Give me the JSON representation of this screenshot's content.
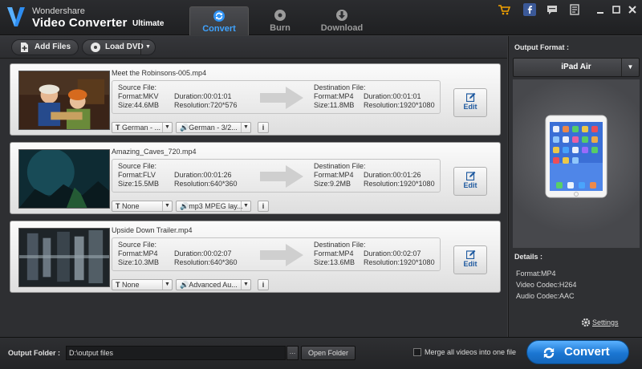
{
  "app": {
    "brand_line1": "Wondershare",
    "brand_line2": "Video Converter",
    "brand_edition": "Ultimate"
  },
  "tabs": [
    {
      "label": "Convert",
      "active": true
    },
    {
      "label": "Burn",
      "active": false
    },
    {
      "label": "Download",
      "active": false
    }
  ],
  "toolbar": {
    "add_files": "Add Files",
    "load_dvd": "Load DVD"
  },
  "files": [
    {
      "name": "Meet the Robinsons-005.mp4",
      "source": {
        "label": "Source File:",
        "format": "Format:MKV",
        "size": "Size:44.6MB",
        "duration": "Duration:00:01:01",
        "resolution": "Resolution:720*576"
      },
      "dest": {
        "label": "Destination File:",
        "format": "Format:MP4",
        "size": "Size:11.8MB",
        "duration": "Duration:00:01:01",
        "resolution": "Resolution:1920*1080"
      },
      "subtitle": "German - ...",
      "audio": "German - 3/2...",
      "edit": "Edit"
    },
    {
      "name": "Amazing_Caves_720.mp4",
      "source": {
        "label": "Source File:",
        "format": "Format:FLV",
        "size": "Size:15.5MB",
        "duration": "Duration:00:01:26",
        "resolution": "Resolution:640*360"
      },
      "dest": {
        "label": "Destination File:",
        "format": "Format:MP4",
        "size": "Size:9.2MB",
        "duration": "Duration:00:01:26",
        "resolution": "Resolution:1920*1080"
      },
      "subtitle": "None",
      "audio": "mp3 MPEG lay...",
      "edit": "Edit"
    },
    {
      "name": "Upside Down Trailer.mp4",
      "source": {
        "label": "Source File:",
        "format": "Format:MP4",
        "size": "Size:10.3MB",
        "duration": "Duration:00:02:07",
        "resolution": "Resolution:640*360"
      },
      "dest": {
        "label": "Destination File:",
        "format": "Format:MP4",
        "size": "Size:13.6MB",
        "duration": "Duration:00:02:07",
        "resolution": "Resolution:1920*1080"
      },
      "subtitle": "None",
      "audio": "Advanced Au...",
      "edit": "Edit"
    }
  ],
  "right_panel": {
    "output_format_label": "Output Format :",
    "output_format_value": "iPad Air",
    "details_label": "Details :",
    "details": [
      "Format:MP4",
      "Video Codec:H264",
      "Audio Codec:AAC"
    ],
    "settings": "Settings"
  },
  "bottom": {
    "output_folder_label": "Output Folder :",
    "output_folder_value": "D:\\output files",
    "browse": "…",
    "open_folder": "Open Folder",
    "merge_label": "Merge all videos into one file",
    "merge_checked": false,
    "convert": "Convert"
  },
  "colors": {
    "accent": "#3fa3ff",
    "convert_button": "#1b76d2",
    "background": "#2e2f32"
  },
  "icons": [
    "cart-icon",
    "facebook-icon",
    "chat-icon",
    "register-icon",
    "minimize-icon",
    "maximize-icon",
    "close-icon",
    "convert-icon",
    "burn-icon",
    "download-icon",
    "add-files-icon",
    "dvd-icon",
    "subtitle-icon",
    "audio-icon",
    "info-icon",
    "edit-icon",
    "gear-icon"
  ]
}
